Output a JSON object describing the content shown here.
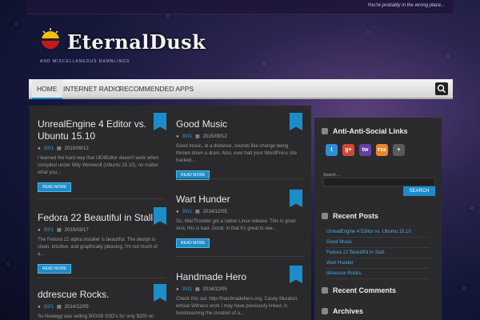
{
  "topbar": {
    "tagline": "You're probably in the wrong place..."
  },
  "site": {
    "title": "EternalDusk",
    "subtitle": "AND MISCELLANEOUS RAMBLINGS"
  },
  "nav": {
    "items": [
      {
        "label": "HOME"
      },
      {
        "label": "INTERNET RADIO"
      },
      {
        "label": "RECOMMENDED APPS"
      }
    ]
  },
  "posts": [
    {
      "title": "UnrealEngine 4 Editor vs. Ubuntu 15.10",
      "author": "3VI1",
      "date": "2015/09/12",
      "excerpt": "I learned the hard way that UE4Editor doesn't work when compiled under Wily Werewolf (Ubuntu 15.10), no matter what you…",
      "read_more": "READ MORE"
    },
    {
      "title": "Fedora 22 Beautiful in Stall.",
      "author": "3VI1",
      "date": "2015/03/17",
      "excerpt": "The Fedora 22 alpha installer is beautiful.  The design is clean, intuitive, and graphically pleasing.  I'm not much of a…",
      "read_more": "READ MORE"
    },
    {
      "title": "ddrescue Rocks.",
      "author": "3VI1",
      "date": "2014/12/05",
      "excerpt": "So Newegg was selling 500GB SSD's for only $200 on Black"
    },
    {
      "title": "Good Music",
      "author": "3VI1",
      "date": "2015/09/12",
      "excerpt": "Good music, at a distance, sounds like change being thrown down a drain.  Also, ever had your WordPress site hacked…",
      "read_more": "READ MORE"
    },
    {
      "title": "Wart Hunder",
      "author": "3VI1",
      "date": "2014/12/05",
      "excerpt": "So, WarThunder got a native Linux release.  This is good.  And, this is bad.  Good, in that it's great to see…",
      "read_more": "READ MORE"
    },
    {
      "title": "Handmade Hero",
      "author": "3VI1",
      "date": "2014/12/05",
      "excerpt": "Check this out:  http://handmadehero.org.  Casey Muratori, whose Witness work I may have previously linked, is livestreaming the creation of a…"
    }
  ],
  "sidebar": {
    "social_title": "Anti-Anti-Social Links",
    "social": [
      {
        "icon": "twitter-icon",
        "glyph": "t",
        "color": "#2f8fd6"
      },
      {
        "icon": "google-plus-icon",
        "glyph": "g+",
        "color": "#d34836"
      },
      {
        "icon": "twitch-icon",
        "glyph": "tw",
        "color": "#6441a5"
      },
      {
        "icon": "rss-icon",
        "glyph": "rss",
        "color": "#e8862a"
      },
      {
        "icon": "delicious-icon",
        "glyph": "+",
        "color": "#5a5a5a"
      }
    ],
    "search_placeholder": "Search ...",
    "search_button": "SEARCH",
    "recent_posts_title": "Recent Posts",
    "recent_posts": [
      "UnrealEngine 4 Editor vs. Ubuntu 15.10",
      "Good Music",
      "Fedora 22 Beautiful in Stall.",
      "Wart Hunder",
      "ddrescue Rocks."
    ],
    "recent_comments_title": "Recent Comments",
    "archives_title": "Archives"
  }
}
